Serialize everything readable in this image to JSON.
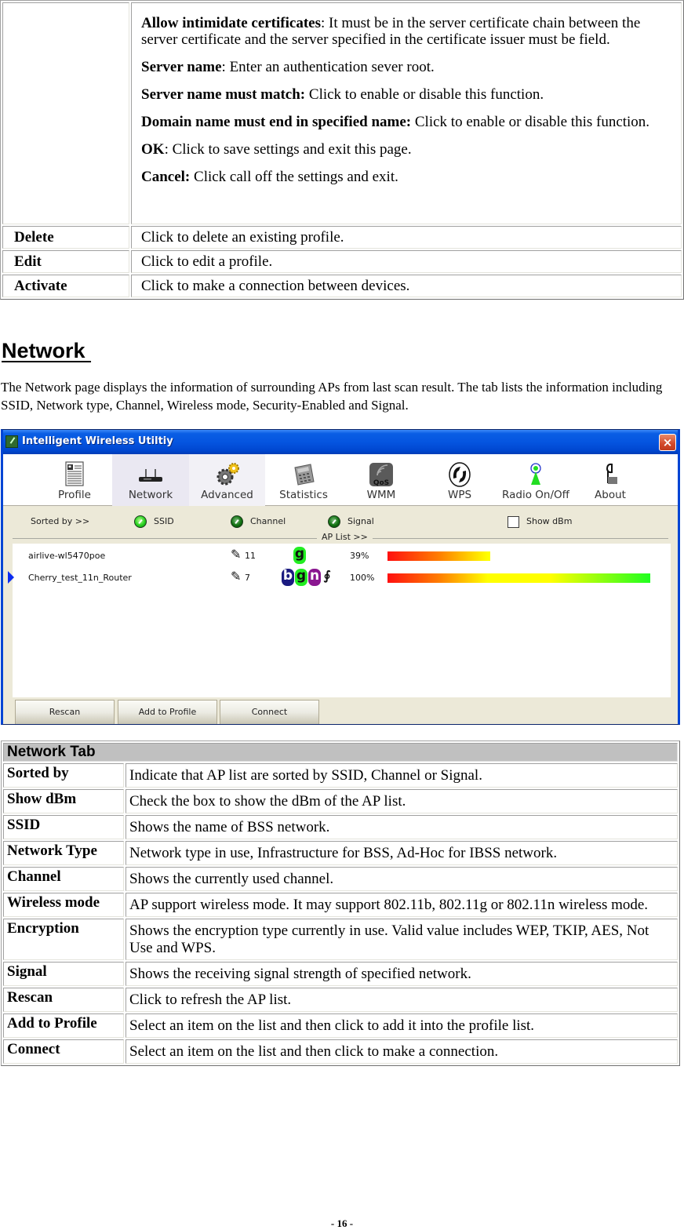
{
  "top_table": {
    "continued_paragraphs": [
      {
        "term": "Allow intimidate certificates",
        "sep": ": ",
        "text": "It must be in the server certificate chain between the server certificate and the server specified in the certificate issuer must be field."
      },
      {
        "term": "Server name",
        "sep": ": ",
        "text": "Enter an authentication sever root."
      },
      {
        "term": "Server name must match:",
        "sep": " ",
        "text": "Click to enable or disable this function."
      },
      {
        "term": "Domain name must end in specified name:",
        "sep": " ",
        "text": "Click to enable or disable this function."
      },
      {
        "term": "OK",
        "sep": ": ",
        "text": "Click to save settings and exit this page."
      },
      {
        "term": "Cancel:",
        "sep": " ",
        "text": "Click call off the settings and exit."
      }
    ],
    "rows": [
      {
        "label": "Delete",
        "desc": "Click to delete an existing profile."
      },
      {
        "label": "Edit",
        "desc": "Click to edit a profile."
      },
      {
        "label": "Activate",
        "desc": "Click to make a connection between devices."
      }
    ]
  },
  "section": {
    "title": "Network ",
    "intro": "The Network page displays the information of surrounding APs from last scan result. The tab lists the information including SSID, Network type, Channel, Wireless mode, Security-Enabled and Signal."
  },
  "app": {
    "title": "Intelligent Wireless Utiltiy",
    "close_icon": "×",
    "toolbar": [
      {
        "label": "Profile",
        "icon": "profile-icon"
      },
      {
        "label": "Network",
        "icon": "network-icon",
        "active": true
      },
      {
        "label": "Advanced",
        "icon": "advanced-icon"
      },
      {
        "label": "Statistics",
        "icon": "statistics-icon"
      },
      {
        "label": "WMM",
        "icon": "wmm-qos-icon"
      },
      {
        "label": "WPS",
        "icon": "wps-icon"
      },
      {
        "label": "Radio On/Off",
        "icon": "radio-icon"
      },
      {
        "label": "About",
        "icon": "about-icon"
      }
    ],
    "sortbar": {
      "sorted_by_label": "Sorted by >>",
      "options": [
        {
          "label": "SSID",
          "selected": true
        },
        {
          "label": "Channel",
          "selected": false
        },
        {
          "label": "Signal",
          "selected": false
        }
      ],
      "show_dbm_label": "Show dBm",
      "show_dbm_checked": false,
      "ap_list_label": "AP List >>"
    },
    "ap_list": [
      {
        "ssid": "airlive-wl5470poe",
        "channel": "11",
        "modes": [
          "g"
        ],
        "wps": false,
        "signal_text": "39%",
        "signal_percent": 39,
        "selected": false
      },
      {
        "ssid": "Cherry_test_11n_Router",
        "channel": "7",
        "modes": [
          "b",
          "g",
          "n"
        ],
        "wps": true,
        "signal_text": "100%",
        "signal_percent": 100,
        "selected": true
      }
    ],
    "buttons": {
      "rescan": "Rescan",
      "add_to_profile": "Add to Profile",
      "connect": "Connect"
    }
  },
  "network_tab_table": {
    "header": "Network Tab",
    "rows": [
      {
        "label": "Sorted by",
        "desc": "Indicate that AP list are sorted by SSID, Channel or Signal."
      },
      {
        "label": "Show dBm",
        "desc": "Check the box to show the dBm of the AP list."
      },
      {
        "label": "SSID",
        "desc": "Shows the name of BSS network."
      },
      {
        "label": "Network Type",
        "desc": "Network type in use, Infrastructure for BSS, Ad-Hoc for IBSS network."
      },
      {
        "label": "Channel",
        "desc": "Shows the currently used channel."
      },
      {
        "label": "Wireless mode",
        "desc": "AP support wireless mode. It may support 802.11b, 802.11g or 802.11n wireless mode."
      },
      {
        "label": "Encryption",
        "desc": "Shows the encryption type currently in use. Valid value includes WEP, TKIP, AES, Not Use and WPS."
      },
      {
        "label": "Signal",
        "desc": "Shows the receiving signal strength of specified network."
      },
      {
        "label": "Rescan",
        "desc": "Click to refresh the AP list."
      },
      {
        "label": "Add to Profile",
        "desc": "Select an item on the list and then click to add it into the profile list."
      },
      {
        "label": "Connect",
        "desc": "Select an item on the list and then click to make a connection."
      }
    ]
  },
  "page_number": "- 16 -"
}
